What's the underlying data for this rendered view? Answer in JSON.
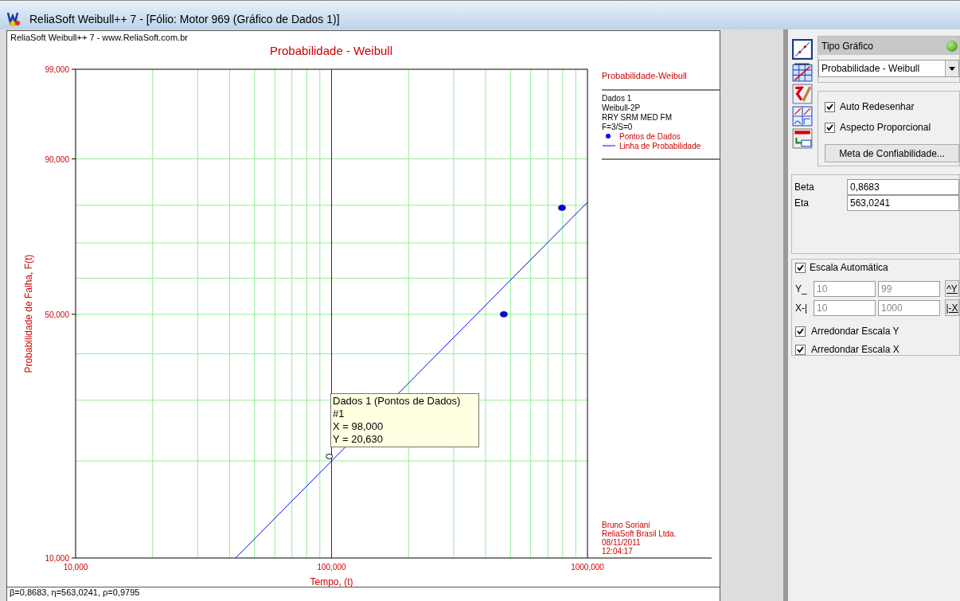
{
  "window": {
    "title": "ReliaSoft Weibull++ 7 - [Fólio: Motor 969 (Gráfico de Dados 1)]"
  },
  "chart_panel": {
    "header": "ReliaSoft Weibull++ 7 - www.ReliaSoft.com.br",
    "chart": {
      "title": "Probabilidade - Weibull",
      "xlabel": "Tempo, (t)",
      "ylabel": "Probabilidade de Falha, F(t)"
    },
    "x_axis_labels": [
      "10,000",
      "100,000",
      "1000,000"
    ],
    "y_axis_labels": [
      "99,000",
      "90,000",
      "50,000",
      "10,000"
    ],
    "legend": {
      "title": "Probabilidade-Weibull",
      "lines": [
        "Dados 1",
        "Weibull-2P",
        "RRY SRM MED FM",
        "F=3/S=0"
      ],
      "items": [
        {
          "kind": "dot",
          "label": "Pontos de Dados",
          "color": "#0000ff"
        },
        {
          "kind": "line",
          "label": "Linha de Probabilidade",
          "color": "#0000ff"
        }
      ]
    },
    "footer_lines": [
      "Bruno Soriani",
      "ReliaSoft Brasil Ltda.",
      "08/11/2011",
      "12:04:17"
    ],
    "tooltip": {
      "lines": [
        "Dados 1 (Pontos de Dados)",
        "#1",
        "X = 98,000",
        "Y = 20,630"
      ]
    }
  },
  "status_bar": "β=0,8683, η=563,0241, ρ=0,9795",
  "side_panel": {
    "chart_type": {
      "label": "Tipo Gráfico",
      "value": "Probabilidade - Weibull"
    },
    "options": [
      {
        "label": "Auto Redesenhar",
        "checked": true
      },
      {
        "label": "Aspecto Proporcional",
        "checked": true
      }
    ],
    "goal_button": "Meta de Confiabilidade...",
    "parameters": [
      {
        "label": "Beta",
        "value": "0,8683"
      },
      {
        "label": "Eta",
        "value": "563,0241"
      }
    ],
    "scale": {
      "label": "Escala Automática",
      "checked": true,
      "rows": [
        {
          "label": "Y_",
          "min": "10",
          "max": "99",
          "button": "^Y"
        },
        {
          "label": "X-|",
          "min": "10",
          "max": "1000",
          "button": "|-X"
        }
      ],
      "rounding": [
        {
          "label": "Arredondar Escala Y",
          "checked": true
        },
        {
          "label": "Arredondar Escala X",
          "checked": true
        }
      ]
    }
  }
}
